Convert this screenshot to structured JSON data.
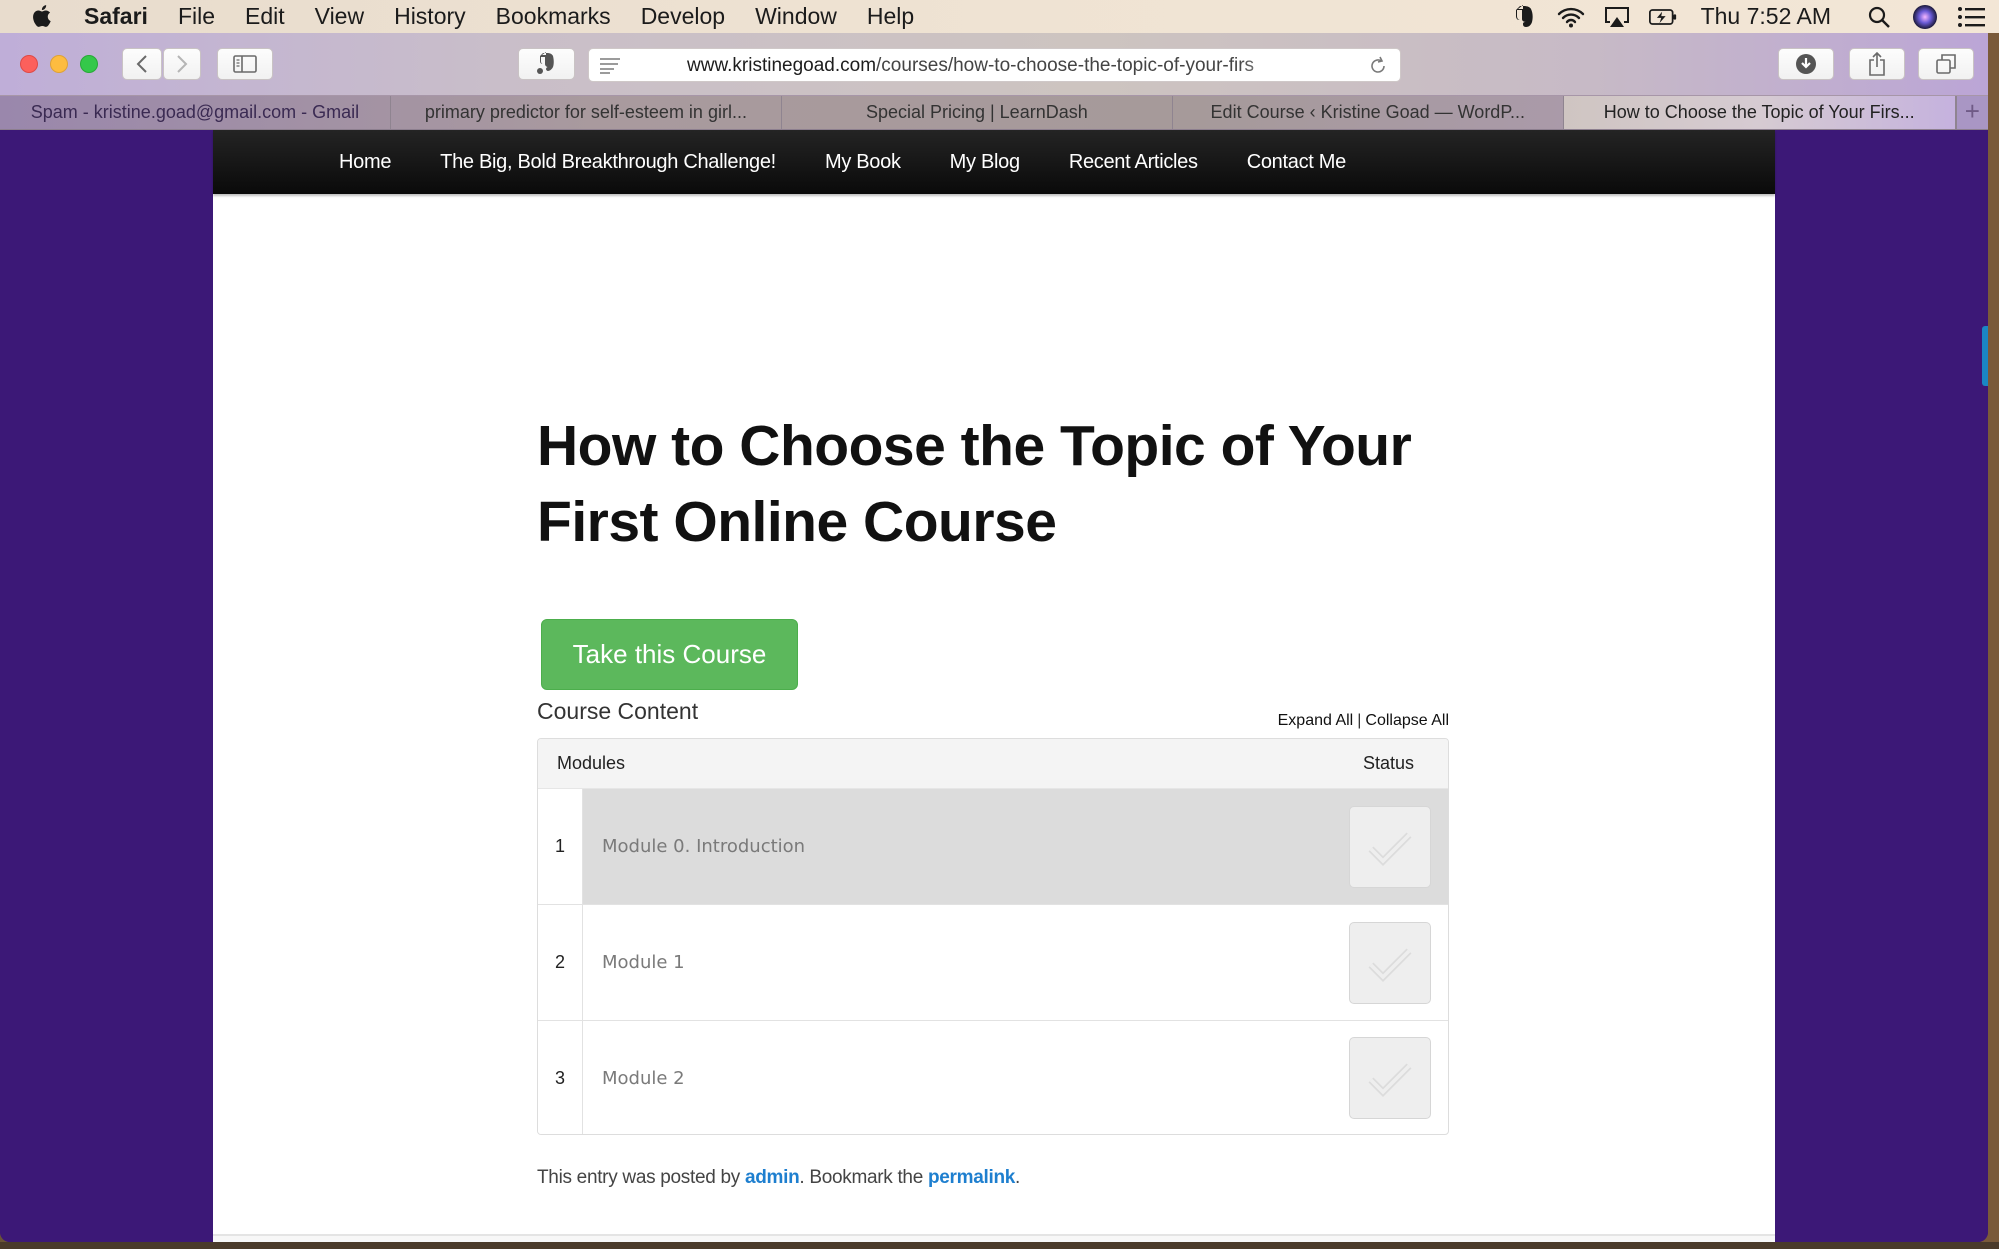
{
  "menubar": {
    "app_name": "Safari",
    "items": [
      "File",
      "Edit",
      "View",
      "History",
      "Bookmarks",
      "Develop",
      "Window",
      "Help"
    ],
    "clock": "Thu 7:52 AM",
    "status_icons": [
      "evernote-icon",
      "wifi-icon",
      "airplay-icon",
      "battery-icon",
      "spotlight-search-icon",
      "siri-icon",
      "notification-center-icon"
    ]
  },
  "toolbar": {
    "url_domain": "www.kristinegoad.com",
    "url_path": "/courses/how-to-choose-the-topic-of-your-firs"
  },
  "tabs": [
    {
      "label": "Spam - kristine.goad@gmail.com - Gmail",
      "active": false
    },
    {
      "label": "primary predictor for self-esteem in girl...",
      "active": false
    },
    {
      "label": "Special Pricing | LearnDash",
      "active": false
    },
    {
      "label": "Edit Course ‹ Kristine Goad — WordP...",
      "active": false
    },
    {
      "label": "How to Choose the Topic of Your Firs...",
      "active": true
    }
  ],
  "new_tab_label": "+",
  "site_nav": [
    "Home",
    "The Big, Bold Breakthrough Challenge!",
    "My Book",
    "My Blog",
    "Recent Articles",
    "Contact Me"
  ],
  "page": {
    "title": "How to Choose the Topic of Your First Online Course",
    "take_course_label": "Take this Course",
    "course_content_label": "Course Content",
    "expand_all": "Expand All",
    "separator": "|",
    "collapse_all": "Collapse All",
    "table": {
      "col_modules": "Modules",
      "col_status": "Status",
      "rows": [
        {
          "num": "1",
          "title": "Module 0. Introduction",
          "completed": false,
          "highlighted": true
        },
        {
          "num": "2",
          "title": "Module 1",
          "completed": false,
          "highlighted": false
        },
        {
          "num": "3",
          "title": "Module 2",
          "completed": false,
          "highlighted": false
        }
      ]
    },
    "meta": {
      "prefix": "This entry was posted by ",
      "author": "admin",
      "middle": ". Bookmark the ",
      "permalink": "permalink",
      "suffix": "."
    }
  },
  "colors": {
    "background_purple": "#3c1877",
    "button_green": "#5cb85c",
    "link_blue": "#1e7fcf",
    "nav_black": "#111111"
  }
}
